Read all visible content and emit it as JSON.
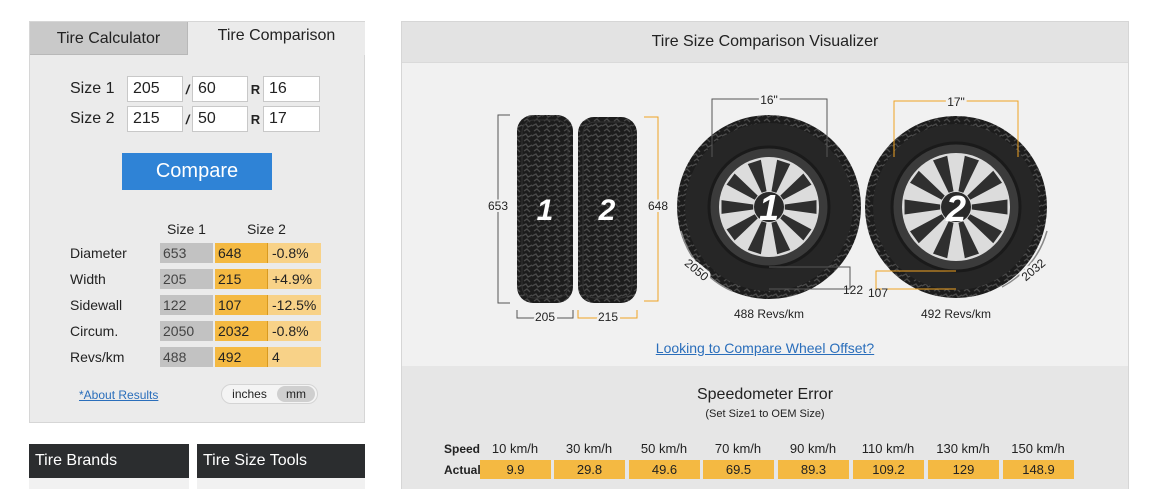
{
  "tabs": {
    "calculator": "Tire Calculator",
    "comparison": "Tire Comparison"
  },
  "sizes": {
    "size1": {
      "label": "Size 1",
      "width": "205",
      "aspect": "60",
      "rim": "16"
    },
    "size2": {
      "label": "Size 2",
      "width": "215",
      "aspect": "50",
      "rim": "17"
    },
    "slash": "/",
    "r": "R"
  },
  "compare_label": "Compare",
  "results": {
    "head_size1": "Size 1",
    "head_size2": "Size 2",
    "rows": [
      {
        "label": "Diameter",
        "s1": "653",
        "s2": "648",
        "diff": "-0.8%"
      },
      {
        "label": "Width",
        "s1": "205",
        "s2": "215",
        "diff": "+4.9%"
      },
      {
        "label": "Sidewall",
        "s1": "122",
        "s2": "107",
        "diff": "-12.5%"
      },
      {
        "label": "Circum.",
        "s1": "2050",
        "s2": "2032",
        "diff": "-0.8%"
      },
      {
        "label": "Revs/km",
        "s1": "488",
        "s2": "492",
        "diff": "4"
      }
    ]
  },
  "about_label": "*About Results",
  "units": {
    "inches": "inches",
    "mm": "mm",
    "selected": "mm"
  },
  "bottom_tabs": {
    "brands": "Tire Brands",
    "tools": "Tire Size Tools"
  },
  "visualizer": {
    "title": "Tire Size Comparison Visualizer",
    "tire1": {
      "number": "1",
      "diameter": "653",
      "width": "205",
      "rim": "16\"",
      "sidewall": "122",
      "circum": "2050",
      "revs": "488 Revs/km"
    },
    "tire2": {
      "number": "2",
      "diameter": "648",
      "width": "215",
      "rim": "17\"",
      "sidewall": "107",
      "circum": "2032",
      "revs": "492 Revs/km"
    },
    "offset_link": "Looking to Compare Wheel Offset?",
    "colors": {
      "dim_gray": "#555555",
      "dim_orange": "#f0a322",
      "tire": "#1f1f1f",
      "rim": "#3a3a3a"
    }
  },
  "speedometer": {
    "title": "Speedometer Error",
    "subtitle": "(Set Size1 to OEM Size)",
    "speed_label": "Speed",
    "actual_label": "Actual",
    "speeds": [
      "10 km/h",
      "30 km/h",
      "50 km/h",
      "70 km/h",
      "90 km/h",
      "110 km/h",
      "130 km/h",
      "150 km/h"
    ],
    "actuals": [
      "9.9",
      "29.8",
      "49.6",
      "69.5",
      "89.3",
      "109.2",
      "129",
      "148.9"
    ]
  }
}
